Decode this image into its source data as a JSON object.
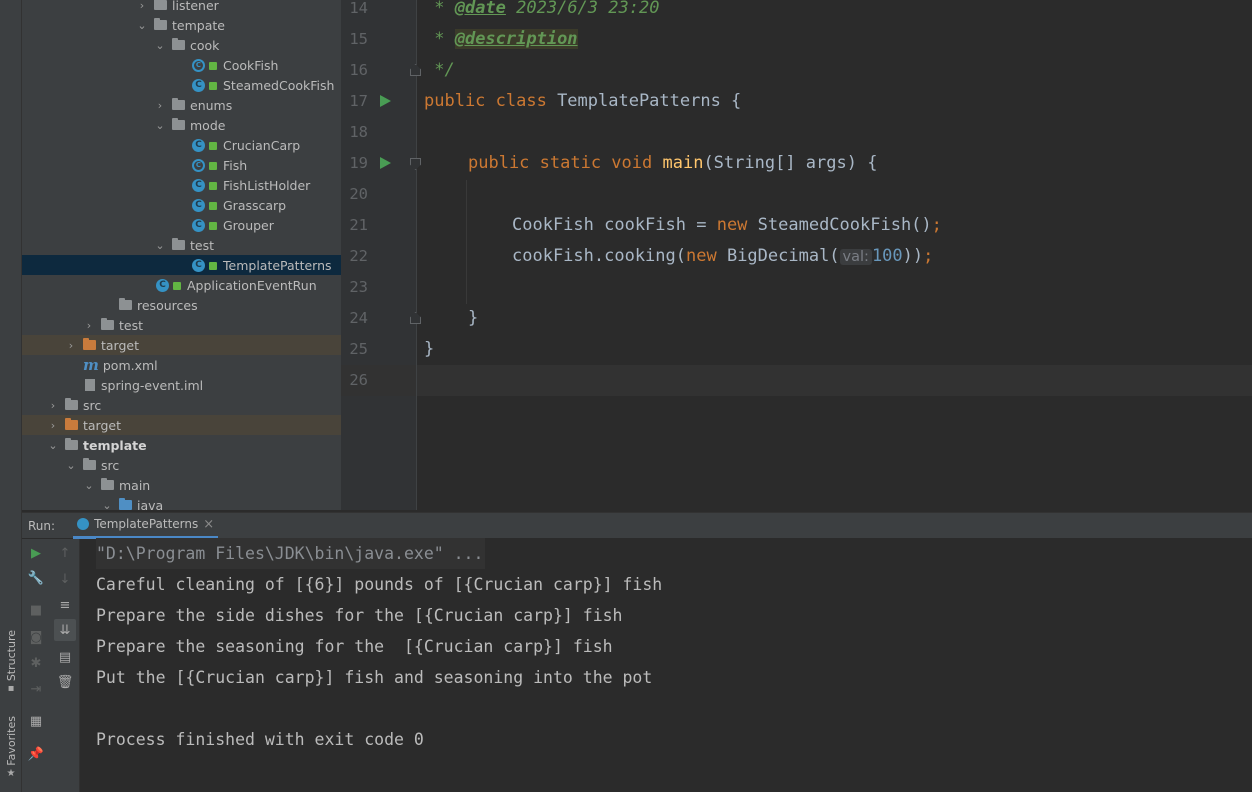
{
  "left_strip": {
    "structure_label": "Structure",
    "favorites_label": "Favorites"
  },
  "project_tree": {
    "rows": [
      {
        "label": "listener",
        "kind": "folder"
      },
      {
        "label": "tempate",
        "kind": "folder"
      },
      {
        "label": "cook",
        "kind": "folder"
      },
      {
        "label": "CookFish",
        "kind": "abstract-class"
      },
      {
        "label": "SteamedCookFish",
        "kind": "class"
      },
      {
        "label": "enums",
        "kind": "folder"
      },
      {
        "label": "mode",
        "kind": "folder"
      },
      {
        "label": "CrucianCarp",
        "kind": "class"
      },
      {
        "label": "Fish",
        "kind": "abstract-class"
      },
      {
        "label": "FishListHolder",
        "kind": "class"
      },
      {
        "label": "Grasscarp",
        "kind": "class"
      },
      {
        "label": "Grouper",
        "kind": "class"
      },
      {
        "label": "test",
        "kind": "folder"
      },
      {
        "label": "TemplatePatterns",
        "kind": "class",
        "selected": true
      },
      {
        "label": "ApplicationEventRun",
        "kind": "spring-class"
      },
      {
        "label": "resources",
        "kind": "folder"
      },
      {
        "label": "test",
        "kind": "folder"
      },
      {
        "label": "target",
        "kind": "excluded-folder"
      },
      {
        "label": "pom.xml",
        "kind": "maven"
      },
      {
        "label": "spring-event.iml",
        "kind": "iml"
      },
      {
        "label": "src",
        "kind": "folder"
      },
      {
        "label": "target",
        "kind": "excluded-folder"
      },
      {
        "label": "template",
        "kind": "module"
      },
      {
        "label": "src",
        "kind": "folder"
      },
      {
        "label": "main",
        "kind": "folder"
      },
      {
        "label": "java",
        "kind": "source-folder"
      }
    ]
  },
  "editor": {
    "line_numbers": [
      "14",
      "15",
      "16",
      "17",
      "18",
      "19",
      "20",
      "21",
      "22",
      "23",
      "24",
      "25",
      "26"
    ],
    "code": {
      "l14_prefix": " * ",
      "l14_tag": "@date",
      "l14_rest": " 2023/6/3 23:20",
      "l15_prefix": " * ",
      "l15_tag": "@description",
      "l16": " */",
      "l17_kw": "public class",
      "l17_rest": " TemplatePatterns {",
      "l19_kw": "public static void",
      "l19_fn": "main",
      "l19_rest": "(String[] args) {",
      "l21_a": "CookFish cookFish = ",
      "l21_kw": "new",
      "l21_b": " SteamedCookFish()",
      "l21_semi": ";",
      "l22_a": "cookFish.cooking(",
      "l22_kw": "new",
      "l22_b": " BigDecimal(",
      "l22_hint": "val:",
      "l22_num": "100",
      "l22_c": "))",
      "l22_semi": ";",
      "l24": "}",
      "l25": "}"
    }
  },
  "run_panel": {
    "title": "Run:",
    "tab_label": "TemplatePatterns",
    "tab_close": "×",
    "console_lines": [
      "\"D:\\Program Files\\JDK\\bin\\java.exe\" ...",
      "Careful cleaning of [{6}] pounds of [{Crucian carp}] fish",
      "Prepare the side dishes for the [{Crucian carp}] fish",
      "Prepare the seasoning for the  [{Crucian carp}] fish",
      "Put the [{Crucian carp}] fish and seasoning into the pot",
      "",
      "Process finished with exit code 0"
    ]
  },
  "icons": {
    "rerun": "play-icon",
    "settings": "wrench-icon",
    "stop": "stop-icon",
    "screenshot": "camera-icon",
    "debug": "bug-icon",
    "exit": "exit-icon",
    "layout": "layout-icon",
    "pin": "pin-icon",
    "up": "arrow-up-icon",
    "down": "arrow-down-icon",
    "wrap": "soft-wrap-icon",
    "scroll": "scroll-to-end-icon",
    "print": "print-icon",
    "trash": "trash-icon"
  },
  "colors": {
    "accent": "#4a88c7",
    "run_green": "#499c54",
    "keyword": "#cc7832",
    "doc_green": "#629755"
  }
}
